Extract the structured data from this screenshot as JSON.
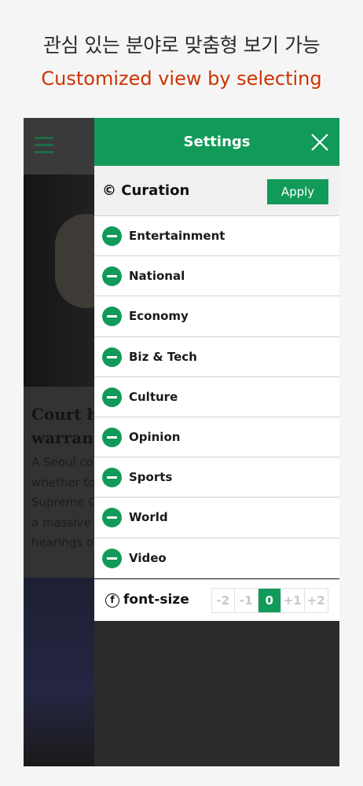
{
  "promo": {
    "korean": "관심 있는 분야로 맞춤형 보기 가능",
    "english": "Customized view by selecting"
  },
  "background_article": {
    "headline": "Court he\nwarrant",
    "body": "A Seoul cou\nwhether to\nSupreme C\na massive p\nhearings of"
  },
  "settings": {
    "title": "Settings",
    "close_icon": "close-icon",
    "curation_label": "© Curation",
    "apply_label": "Apply",
    "categories": [
      {
        "label": "Entertainment"
      },
      {
        "label": "National"
      },
      {
        "label": "Economy"
      },
      {
        "label": "Biz & Tech"
      },
      {
        "label": "Culture"
      },
      {
        "label": "Opinion"
      },
      {
        "label": "Sports"
      },
      {
        "label": "World"
      },
      {
        "label": "Video"
      }
    ],
    "font_size": {
      "label": "font-size",
      "glyph": "f",
      "options": [
        "-2",
        "-1",
        "0",
        "+1",
        "+2"
      ],
      "selected": "0"
    }
  },
  "colors": {
    "accent": "#119a59",
    "promo_english": "#cc3300",
    "overlay": "#2b2b2b"
  }
}
